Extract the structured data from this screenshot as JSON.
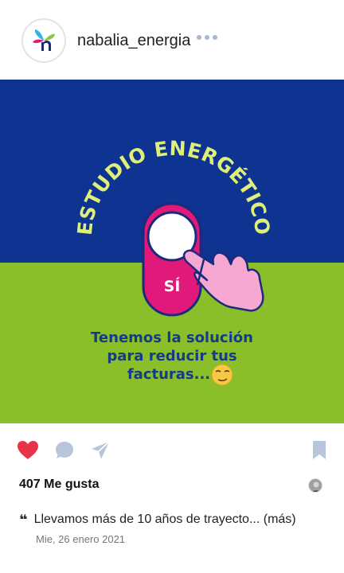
{
  "post": {
    "username": "nabalia_energia",
    "image_text": {
      "headline": "¿ESTUDIO ENERGÉTICO?",
      "button_label": "SÍ",
      "line1": "Tenemos la solución",
      "line2": "para reducir tus",
      "line3": "facturas..."
    },
    "likes_label": "407 Me gusta",
    "caption": "Llevamos más de 10 años de trayecto... (más)",
    "date": "Mie, 26 enero 2021"
  },
  "colors": {
    "top_band": "#0e3390",
    "bottom_band": "#8bbf2a",
    "headline": "#dff07a",
    "switch_pink": "#e0197a",
    "body_text": "#143a8a",
    "like_heart": "#e8334a",
    "icon_grey": "#b8c6dc"
  },
  "icons": {
    "like": "heart-icon",
    "comment": "comment-icon",
    "share": "send-icon",
    "save": "bookmark-icon",
    "more": "more-dots-icon"
  }
}
